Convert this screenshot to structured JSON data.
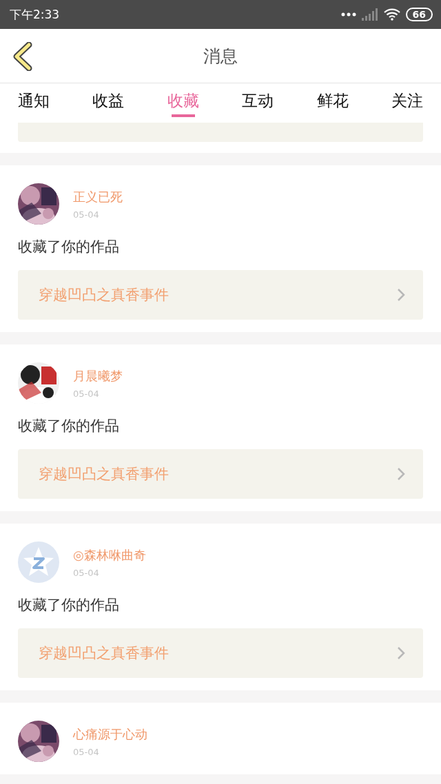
{
  "status_bar": {
    "time": "下午2:33",
    "battery": "66"
  },
  "header": {
    "title": "消息"
  },
  "tabs": [
    {
      "label": "通知",
      "selected": false
    },
    {
      "label": "收益",
      "selected": false
    },
    {
      "label": "收藏",
      "selected": true
    },
    {
      "label": "互动",
      "selected": false
    },
    {
      "label": "鲜花",
      "selected": false
    },
    {
      "label": "关注",
      "selected": false
    }
  ],
  "messages": [
    {
      "name": "正义已死",
      "date": "05-04",
      "text": "收藏了你的作品",
      "work": "穿越凹凸之真香事件"
    },
    {
      "name": "月晨曦梦",
      "date": "05-04",
      "text": "收藏了你的作品",
      "work": "穿越凹凸之真香事件"
    },
    {
      "avatar": {
        "kind": "default"
      },
      "name": "◎森林咻曲奇",
      "date": "05-04",
      "text": "收藏了你的作品",
      "work": "穿越凹凸之真香事件"
    },
    {
      "name": "心痛源于心动",
      "date": "05-04"
    }
  ]
}
